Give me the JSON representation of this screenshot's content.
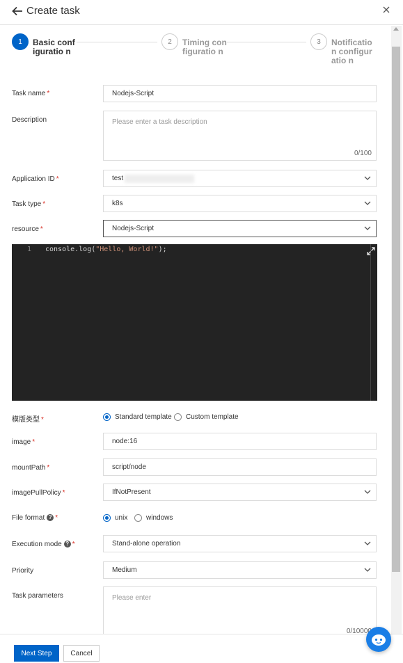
{
  "header": {
    "title": "Create task"
  },
  "steps": [
    {
      "number": "1",
      "title": "Basic configuratio n",
      "active": true
    },
    {
      "number": "2",
      "title": "Timing configuratio n",
      "active": false
    },
    {
      "number": "3",
      "title": "Notification configuratio n",
      "active": false
    }
  ],
  "form": {
    "task_name": {
      "label": "Task name",
      "value": "Nodejs-Script"
    },
    "description": {
      "label": "Description",
      "placeholder": "Please enter a task description",
      "counter": "0/100"
    },
    "application_id": {
      "label": "Application ID",
      "value": "test"
    },
    "task_type": {
      "label": "Task type",
      "value": "k8s"
    },
    "resource": {
      "label": "resource",
      "value": "Nodejs-Script"
    },
    "editor": {
      "line_number": "1",
      "code_prefix": "console.log(",
      "code_string": "\"Hello, World!\"",
      "code_suffix": ");"
    },
    "template_type": {
      "label": "模版类型",
      "option1": "Standard template",
      "option2": "Custom template",
      "selected": "Standard template"
    },
    "image": {
      "label": "image",
      "value": "node:16"
    },
    "mount_path": {
      "label": "mountPath",
      "value": "script/node"
    },
    "image_pull_policy": {
      "label": "imagePullPolicy",
      "value": "IfNotPresent"
    },
    "file_format": {
      "label": "File format",
      "option1": "unix",
      "option2": "windows",
      "selected": "unix"
    },
    "execution_mode": {
      "label": "Execution mode",
      "value": "Stand-alone operation"
    },
    "priority": {
      "label": "Priority",
      "value": "Medium"
    },
    "task_parameters": {
      "label": "Task parameters",
      "placeholder": "Please enter",
      "counter": "0/10000"
    }
  },
  "footer": {
    "next_label": "Next Step",
    "cancel_label": "Cancel"
  },
  "colors": {
    "accent": "#0064c8",
    "required": "#d93026",
    "editor_bg": "#232323"
  }
}
